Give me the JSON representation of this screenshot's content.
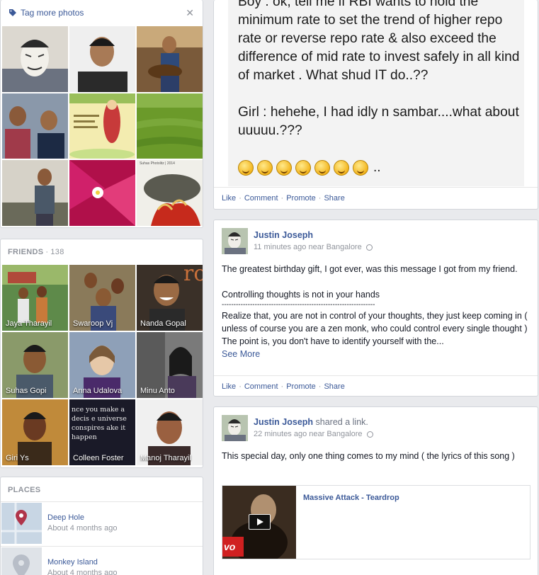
{
  "photos": {
    "tag_label": "Tag more photos",
    "close_glyph": "✕",
    "tiles": [
      {
        "color1": "#d8d4cc",
        "color2": "#6b7280"
      },
      {
        "color1": "#4a4a4a",
        "color2": "#c8b8a8"
      },
      {
        "color1": "#6b5030",
        "color2": "#2e4a7a"
      },
      {
        "color1": "#7a8aa0",
        "color2": "#1c2a44"
      },
      {
        "color1": "#f3ecb0",
        "color2": "#c73a3a"
      },
      {
        "color1": "#6b9a2a",
        "color2": "#8ab44a"
      },
      {
        "color1": "#c9c4b8",
        "color2": "#4a5868"
      },
      {
        "color1": "#b0104a",
        "color2": "#e23c7a"
      },
      {
        "color1": "#f0efe9",
        "color2": "#c62a1c"
      }
    ],
    "watermark": "Suhas Photolitz | 2014"
  },
  "friends": {
    "heading": "FRIENDS",
    "separator": "·",
    "count": "138",
    "items": [
      {
        "name": "Jaya Tharayil",
        "color1": "#5e8a4a",
        "color2": "#b04a3a"
      },
      {
        "name": "Swaroop Vj",
        "color1": "#8a7a5a",
        "color2": "#3a4a7a"
      },
      {
        "name": "Nanda Gopal",
        "color1": "#3a3028",
        "color2": "#c9703a"
      },
      {
        "name": "Suhas Gopi",
        "color1": "#6a7a4a",
        "color2": "#8a9a6a"
      },
      {
        "name": "Anna Udalova",
        "color1": "#8ea0b8",
        "color2": "#4a2a6a"
      },
      {
        "name": "Minu Anto",
        "color1": "#7a7a7a",
        "color2": "#4a3a5a"
      },
      {
        "name": "Giri Ys",
        "color1": "#c08a3a",
        "color2": "#3a2a1a"
      },
      {
        "name": "Colleen Foster",
        "color1": "#1a1a28",
        "color2": "#2a2a3a"
      },
      {
        "name": "Manoj Tharayil",
        "color1": "#f0f0f0",
        "color2": "#3a2a2a"
      }
    ],
    "quote_text": "nce you make a decis e universe conspires ake it happen"
  },
  "places": {
    "heading": "PLACES",
    "items": [
      {
        "name": "Deep Hole",
        "time": "About 4 months ago"
      },
      {
        "name": "Monkey Island",
        "time": "About 4 months ago"
      }
    ]
  },
  "post1": {
    "image_text": [
      "Boy : ok, tell me if RBI wants to hold the minimum rate to set the trend of higher repo rate or reverse repo rate & also exceed the difference of mid rate to invest safely in all kind of market . What shud IT do..??",
      "Girl : hehehe, I had idly n sambar....what about uuuuu.???"
    ],
    "ellipsis": "..",
    "emoji_count": 7,
    "actions": {
      "like": "Like",
      "comment": "Comment",
      "promote": "Promote",
      "share": "Share",
      "sep": "·"
    }
  },
  "post2": {
    "author": "Justin Joseph",
    "time": "11 minutes ago",
    "near": "near",
    "location": "Bangalore",
    "paragraphs": [
      "The greatest birthday gift, I got ever, was this message I got from my friend.",
      "Controlling thoughts is not in your hands",
      "-----------------------------------------------------------------",
      "Realize that, you are not in control of your thoughts, they just keep coming in ( unless of course you are a zen monk, who could control every single thought ) The point is, you don't have to identify yourself with the..."
    ],
    "see_more": "See More",
    "actions": {
      "like": "Like",
      "comment": "Comment",
      "promote": "Promote",
      "share": "Share",
      "sep": "·"
    }
  },
  "post3": {
    "author": "Justin Joseph",
    "verb": "shared a link.",
    "time": "22 minutes ago",
    "near": "near",
    "location": "Bangalore",
    "text": "This special day, only one thing comes to my mind ( the lyrics of this song )",
    "link_title": "Massive Attack - Teardrop",
    "thumb_logo": "vo"
  },
  "colors": {
    "link": "#3b5998",
    "muted": "#90949c",
    "background": "#e9eaed"
  }
}
